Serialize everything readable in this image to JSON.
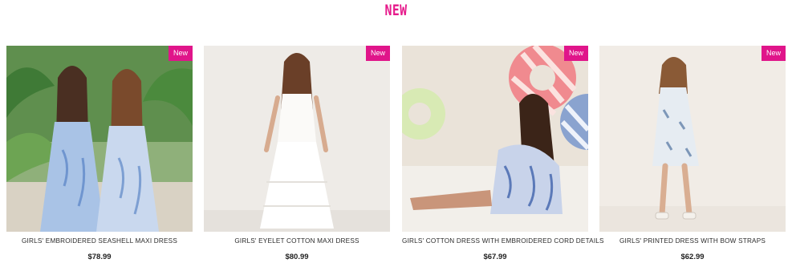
{
  "section": {
    "title": "NEW"
  },
  "colors": {
    "accent": "#e6198b",
    "badge": "#e0158a"
  },
  "products": [
    {
      "badge": "New",
      "name": "GIRLS' EMBROIDERED SEASHELL MAXI DRESS",
      "price": "$78.99",
      "image": "photo-two-girls-blue-floral-dresses"
    },
    {
      "badge": "New",
      "name": "GIRLS' EYELET COTTON MAXI DRESS",
      "price": "$80.99",
      "image": "photo-girl-white-eyelet-maxi-dress"
    },
    {
      "badge": "New",
      "name": "GIRLS' COTTON DRESS WITH EMBROIDERED CORD DETAILS",
      "price": "$67.99",
      "image": "photo-girl-sitting-blue-print-dress"
    },
    {
      "badge": "New",
      "name": "GIRLS' PRINTED DRESS WITH BOW STRAPS",
      "price": "$62.99",
      "image": "photo-girl-printed-dress-bow-straps"
    }
  ]
}
